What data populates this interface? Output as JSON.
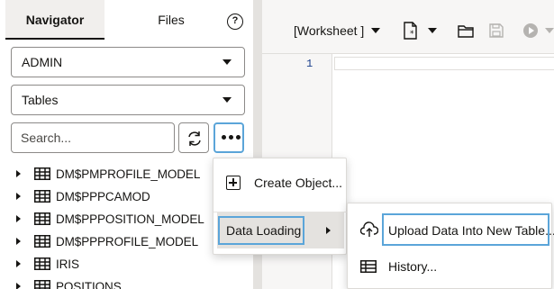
{
  "navigator": {
    "tabs": [
      {
        "label": "Navigator",
        "active": true
      },
      {
        "label": "Files",
        "active": false
      }
    ],
    "help_icon": "?",
    "schema_select": {
      "value": "ADMIN"
    },
    "object_type_select": {
      "value": "Tables"
    },
    "search": {
      "placeholder": "Search...",
      "value": ""
    },
    "tree_items": [
      {
        "label": "DM$PMPROFILE_MODEL"
      },
      {
        "label": "DM$PPPCAMOD"
      },
      {
        "label": "DM$PPPOSITION_MODEL"
      },
      {
        "label": "DM$PPPROFILE_MODEL"
      },
      {
        "label": "IRIS"
      },
      {
        "label": "POSITIONS"
      }
    ]
  },
  "worksheet": {
    "selector_label": "[Worksheet ]",
    "line_numbers": [
      "1"
    ]
  },
  "context_menu": {
    "items": [
      {
        "label": "Create Object...",
        "icon": "plus-square-icon"
      },
      {
        "label": "Data Loading",
        "icon": "submenu-arrow-icon",
        "highlighted": true
      }
    ]
  },
  "submenu": {
    "items": [
      {
        "label": "Upload Data Into New Table...",
        "icon": "cloud-upload-icon",
        "highlighted": true
      },
      {
        "label": "History...",
        "icon": "history-table-icon"
      }
    ]
  },
  "colors": {
    "highlight_outline": "#5ba5d9",
    "active_tab_bg": "#f1efed",
    "hover_bg": "#e4e2df",
    "line_number": "#1a3f8c"
  }
}
